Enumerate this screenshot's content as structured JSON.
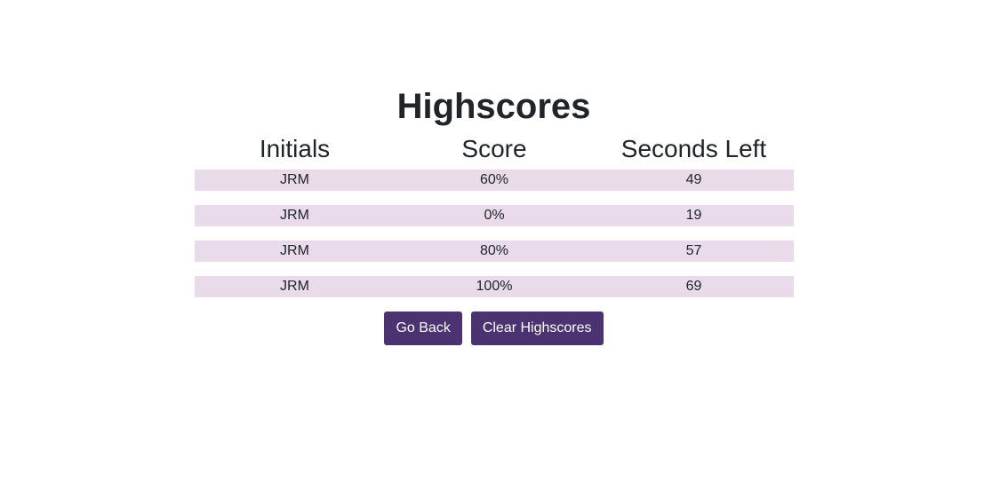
{
  "page": {
    "title": "Highscores"
  },
  "table": {
    "headers": [
      "Initials",
      "Score",
      "Seconds Left"
    ],
    "rows": [
      {
        "initials": "JRM",
        "score": "60%",
        "seconds_left": "49"
      },
      {
        "initials": "JRM",
        "score": "0%",
        "seconds_left": "19"
      },
      {
        "initials": "JRM",
        "score": "80%",
        "seconds_left": "57"
      },
      {
        "initials": "JRM",
        "score": "100%",
        "seconds_left": "69"
      }
    ]
  },
  "buttons": {
    "go_back_label": "Go Back",
    "clear_label": "Clear Highscores"
  },
  "colors": {
    "row_background": "#e9dbea",
    "button_background": "#4b3270",
    "button_text": "#ffffff",
    "text": "#212529"
  }
}
